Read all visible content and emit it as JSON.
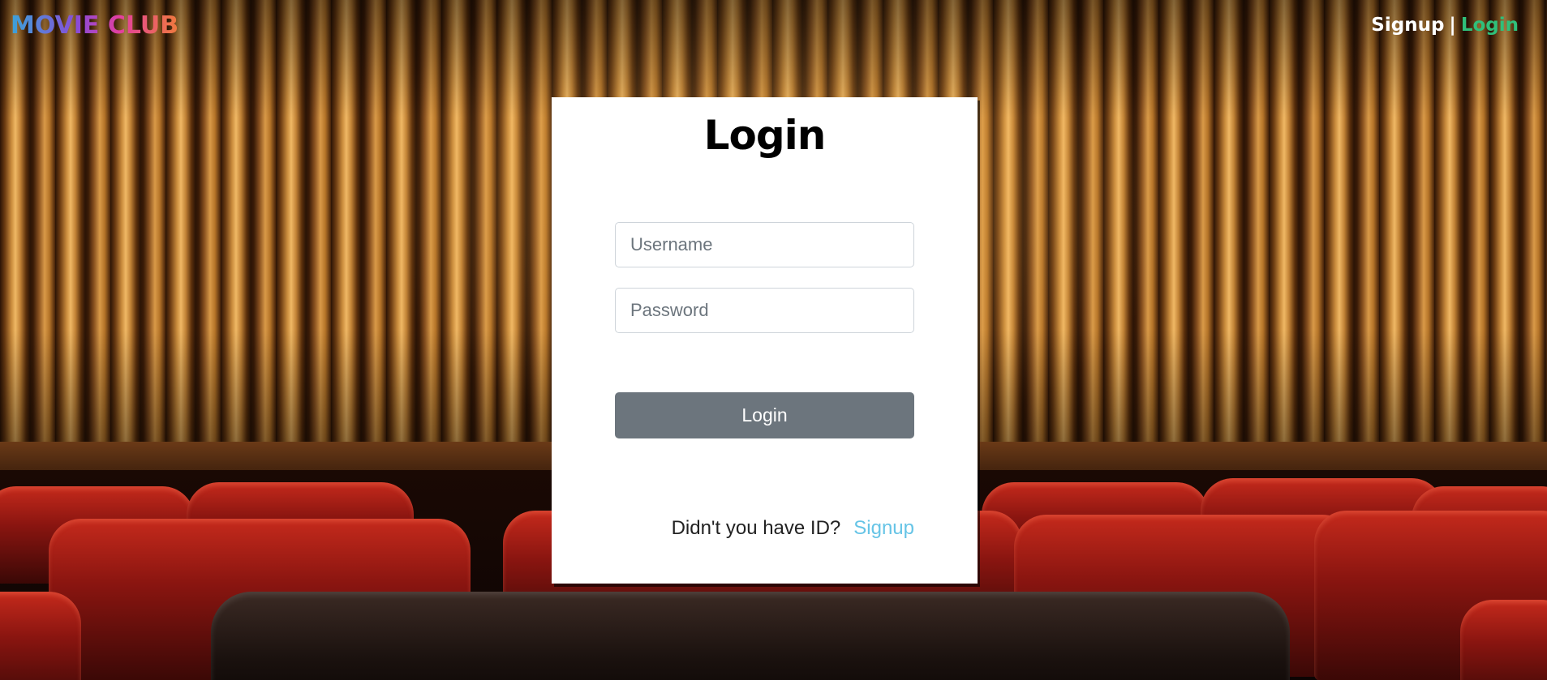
{
  "brand": {
    "name": "MOVIE CLUB"
  },
  "topnav": {
    "signup": "Signup",
    "separator": "|",
    "login": "Login"
  },
  "login_card": {
    "title": "Login",
    "username_placeholder": "Username",
    "password_placeholder": "Password",
    "submit_label": "Login",
    "prompt_text": "Didn't you have ID?",
    "signup_link": "Signup"
  },
  "colors": {
    "nav_login": "#2fbf7a",
    "signup_link": "#66c4e6",
    "button": "#6c757d"
  }
}
